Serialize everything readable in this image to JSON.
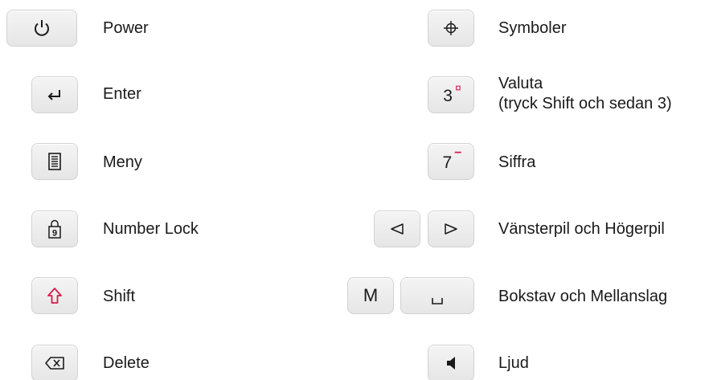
{
  "accent_color": "#d81b4a",
  "left": [
    {
      "icon": "power-icon",
      "label": "Power"
    },
    {
      "icon": "enter-icon",
      "label": "Enter"
    },
    {
      "icon": "menu-icon",
      "label": "Meny"
    },
    {
      "icon": "number-lock-icon",
      "lock_digit": "9",
      "label": "Number Lock"
    },
    {
      "icon": "shift-icon",
      "label": "Shift"
    },
    {
      "icon": "delete-icon",
      "label": "Delete"
    }
  ],
  "right": [
    {
      "icon": "symbols-icon",
      "label": "Symboler"
    },
    {
      "key_text": "3",
      "key_sup": "¤",
      "label_line1": "Valuta",
      "label_line2": "(tryck Shift och sedan 3)"
    },
    {
      "key_text": "7",
      "key_sup": "−",
      "label": "Siffra"
    },
    {
      "icons": [
        "left-arrow-icon",
        "right-arrow-icon"
      ],
      "label": "Vänsterpil och Högerpil"
    },
    {
      "key_text": "M",
      "icon": "space-icon",
      "label": "Bokstav och Mellanslag"
    },
    {
      "icon": "speaker-icon",
      "label": "Ljud"
    }
  ]
}
